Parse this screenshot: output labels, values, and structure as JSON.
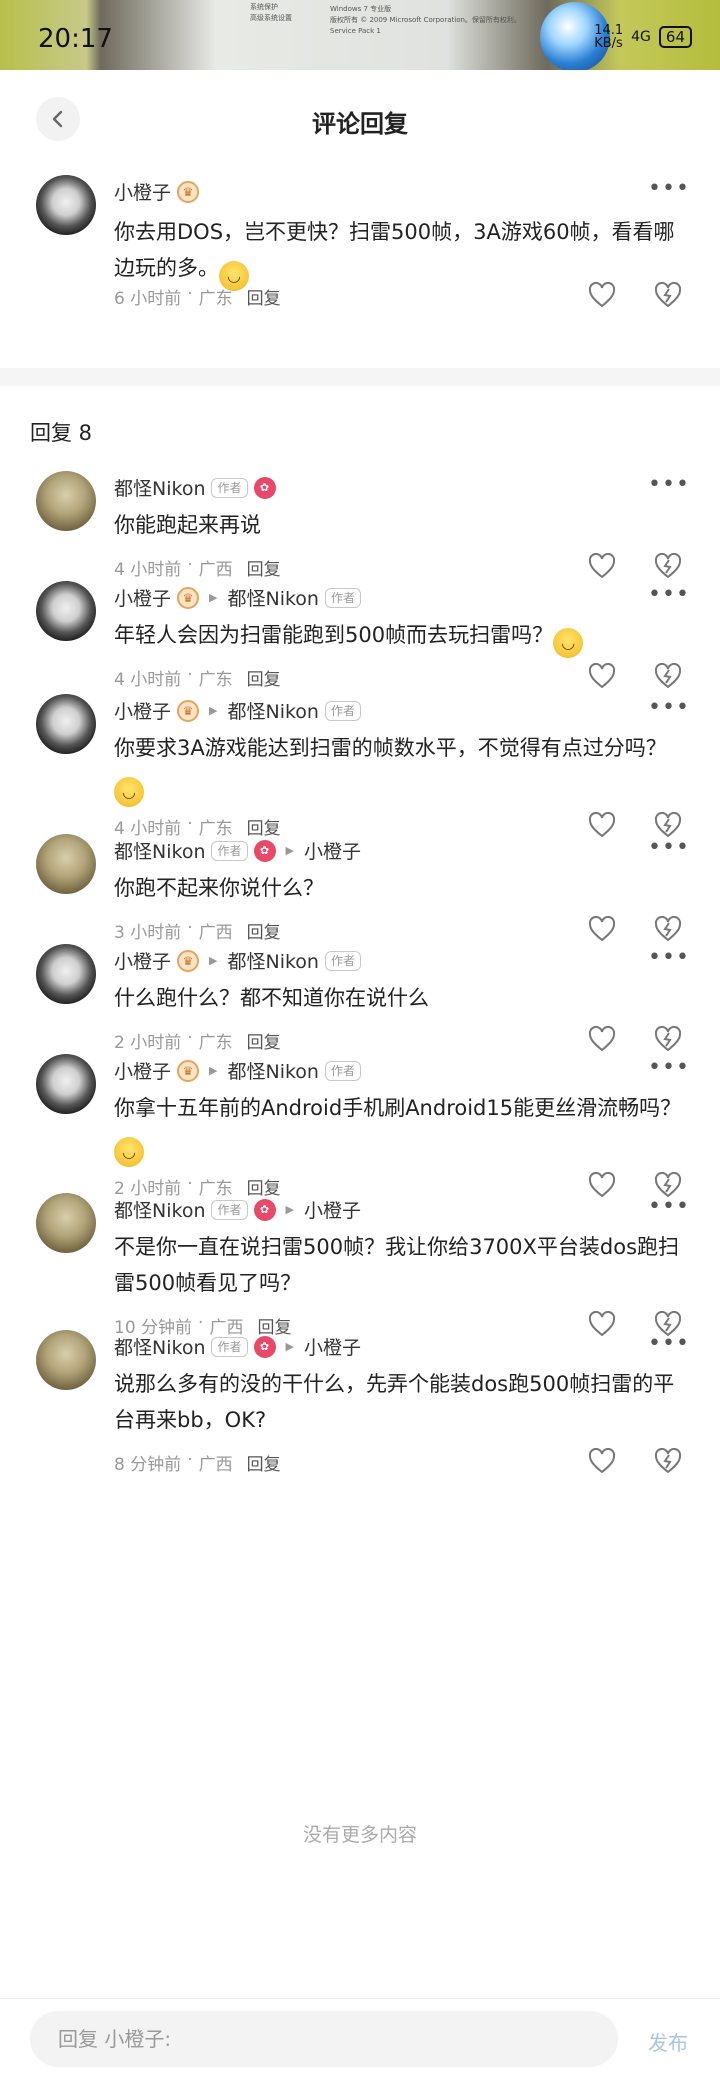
{
  "statusbar": {
    "time": "20:17",
    "sys_lines": [
      "系统保护",
      "高级系统设置",
      "Windows 7 专业版",
      "版权所有 © 2009 Microsoft Corporation。保留所有权利。",
      "Service Pack 1"
    ],
    "net_speed": "14.1\nKB/s",
    "signal": "4G",
    "battery": "64"
  },
  "header": {
    "title": "评论回复"
  },
  "main_comment": {
    "user": "小橙子",
    "text": "你去用DOS，岂不更快？扫雷500帧，3A游戏60帧，看看哪边玩的多。",
    "time": "6 小时前",
    "location": "广东",
    "reply_label": "回复"
  },
  "replies_count_label": "回复 8",
  "replies": [
    {
      "user": "都怪Nikon",
      "author_tag": "作者",
      "badge": "red",
      "to": "",
      "text": "你能跑起来再说",
      "emoji": false,
      "time": "4 小时前",
      "location": "广西",
      "reply_label": "回复"
    },
    {
      "user": "小橙子",
      "author_tag": "",
      "badge": "orange",
      "to": "都怪Nikon",
      "to_tag": "作者",
      "text": "年轻人会因为扫雷能跑到500帧而去玩扫雷吗？",
      "emoji": true,
      "time": "4 小时前",
      "location": "广东",
      "reply_label": "回复"
    },
    {
      "user": "小橙子",
      "author_tag": "",
      "badge": "orange",
      "to": "都怪Nikon",
      "to_tag": "作者",
      "text": "你要求3A游戏能达到扫雷的帧数水平，不觉得有点过分吗？",
      "emoji": true,
      "time": "4 小时前",
      "location": "广东",
      "reply_label": "回复"
    },
    {
      "user": "都怪Nikon",
      "author_tag": "作者",
      "badge": "red",
      "to": "小橙子",
      "text": "你跑不起来你说什么？",
      "emoji": false,
      "time": "3 小时前",
      "location": "广西",
      "reply_label": "回复"
    },
    {
      "user": "小橙子",
      "author_tag": "",
      "badge": "orange",
      "to": "都怪Nikon",
      "to_tag": "作者",
      "text": "什么跑什么？都不知道你在说什么",
      "emoji": false,
      "time": "2 小时前",
      "location": "广东",
      "reply_label": "回复"
    },
    {
      "user": "小橙子",
      "author_tag": "",
      "badge": "orange",
      "to": "都怪Nikon",
      "to_tag": "作者",
      "text": "你拿十五年前的Android手机刷Android15能更丝滑流畅吗？",
      "emoji": true,
      "time": "2 小时前",
      "location": "广东",
      "reply_label": "回复"
    },
    {
      "user": "都怪Nikon",
      "author_tag": "作者",
      "badge": "red",
      "to": "小橙子",
      "text": "不是你一直在说扫雷500帧？我让你给3700X平台装dos跑扫雷500帧看见了吗？",
      "emoji": false,
      "time": "10 分钟前",
      "location": "广西",
      "reply_label": "回复"
    },
    {
      "user": "都怪Nikon",
      "author_tag": "作者",
      "badge": "red",
      "to": "小橙子",
      "text": "说那么多有的没的干什么，先弄个能装dos跑500帧扫雷的平台再来bb，OK?",
      "emoji": false,
      "time": "8 分钟前",
      "location": "广西",
      "reply_label": "回复"
    }
  ],
  "no_more": "没有更多内容",
  "bottom_bar": {
    "placeholder": "回复 小橙子:",
    "publish_label": "发布"
  }
}
